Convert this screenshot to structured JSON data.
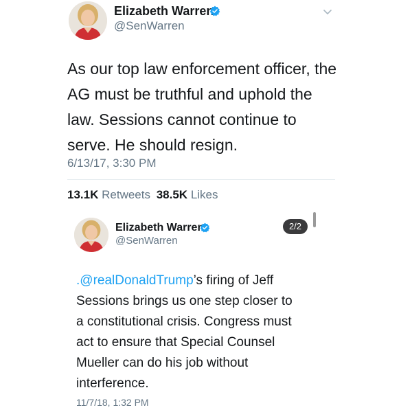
{
  "tweet1": {
    "author_name": "Elizabeth Warren",
    "author_handle": "@SenWarren",
    "text_lines": [
      "As our top law enforcement officer, the",
      "AG must be truthful and uphold the",
      "law. Sessions cannot continue to",
      "serve. He should resign."
    ],
    "timestamp": "6/13/17, 3:30 PM",
    "retweets_count": "13.1K",
    "retweets_label": "Retweets",
    "likes_count": "38.5K",
    "likes_label": "Likes"
  },
  "tweet2": {
    "author_name": "Elizabeth Warren",
    "author_handle": "@SenWarren",
    "page_indicator": "2/2",
    "mention": ".@realDonaldTrump",
    "text_line1_rest": "’s firing of Jeff",
    "text_lines": [
      "Sessions brings us one step closer to",
      "a constitutional crisis. Congress must",
      "act to ensure that Special Counsel",
      "Mueller can do his job without",
      "interference."
    ],
    "timestamp": "11/7/18, 1:32 PM"
  },
  "colors": {
    "accent": "#1da1f2",
    "secondary_text": "#657786"
  }
}
